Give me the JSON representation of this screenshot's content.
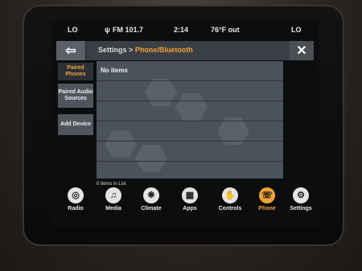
{
  "status": {
    "left_temp": "LO",
    "radio": "FM 101.7",
    "time": "2:14",
    "outside": "76°F out",
    "right_temp": "LO"
  },
  "header": {
    "back_icon": "back-arrow-icon",
    "breadcrumb_root": "Settings",
    "breadcrumb_sep": ">",
    "breadcrumb_current": "Phone/Bluetooth",
    "close_icon": "close-icon",
    "close_glyph": "✕",
    "back_glyph": "⇦",
    "accent": "#f0a23a"
  },
  "tabs": [
    {
      "label": "Paired Phones",
      "active": true
    },
    {
      "label": "Paired Audio Sources",
      "active": false
    },
    {
      "label": "Add Device",
      "active": false
    }
  ],
  "list": {
    "items": [
      "No items"
    ],
    "count_text": "0 items in List"
  },
  "nav": [
    {
      "label": "Radio",
      "icon": "radio-icon",
      "glyph": "◎",
      "active": false
    },
    {
      "label": "Media",
      "icon": "music-note-icon",
      "glyph": "♫",
      "active": false
    },
    {
      "label": "Climate",
      "icon": "climate-icon",
      "glyph": "❋",
      "active": false
    },
    {
      "label": "Apps",
      "icon": "apps-icon",
      "glyph": "▦",
      "active": false
    },
    {
      "label": "Controls",
      "icon": "controls-icon",
      "glyph": "✋",
      "active": false
    },
    {
      "label": "Phone",
      "icon": "phone-icon",
      "glyph": "☏",
      "active": true
    },
    {
      "label": "Settings",
      "icon": "gear-icon",
      "glyph": "⚙",
      "active": false
    }
  ]
}
